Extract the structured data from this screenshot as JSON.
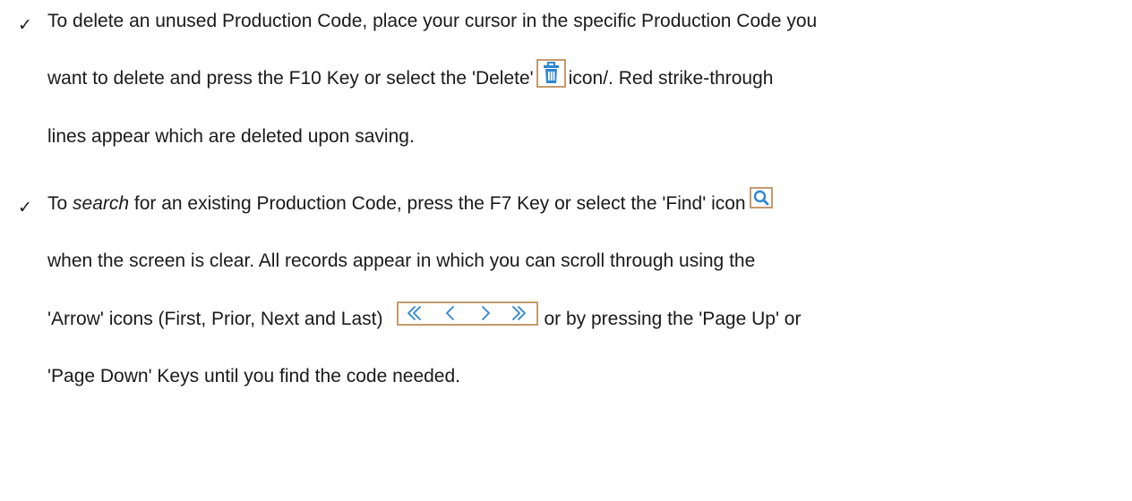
{
  "bullets": [
    {
      "lines": [
        {
          "text": "To delete an unused Production Code, place your cursor in the specific Production Code you"
        },
        {
          "before": "want to delete and press the F10 Key or select the 'Delete'",
          "after": "icon/.  Red strike-through"
        },
        {
          "text": "lines appear which are deleted upon saving."
        }
      ],
      "icon": "trash-icon"
    },
    {
      "lines": [
        {
          "pre": "To ",
          "italic": "search",
          "post": " for an existing Production Code, press the F7 Key or select the 'Find' icon"
        },
        {
          "text": "when the screen is clear.  All records appear in which you can scroll through using the"
        },
        {
          "before": "'Arrow' icons (First, Prior, Next and Last)",
          "after": "or by pressing the 'Page Up' or"
        },
        {
          "text": "'Page Down' Keys until you find the code needed."
        }
      ],
      "icons": [
        "search-icon",
        "first-record-icon",
        "prior-record-icon",
        "next-record-icon",
        "last-record-icon"
      ]
    }
  ],
  "colors": {
    "icon_blue": "#2e86d1",
    "icon_border": "#c49a6c",
    "text": "#1a1a1a"
  }
}
